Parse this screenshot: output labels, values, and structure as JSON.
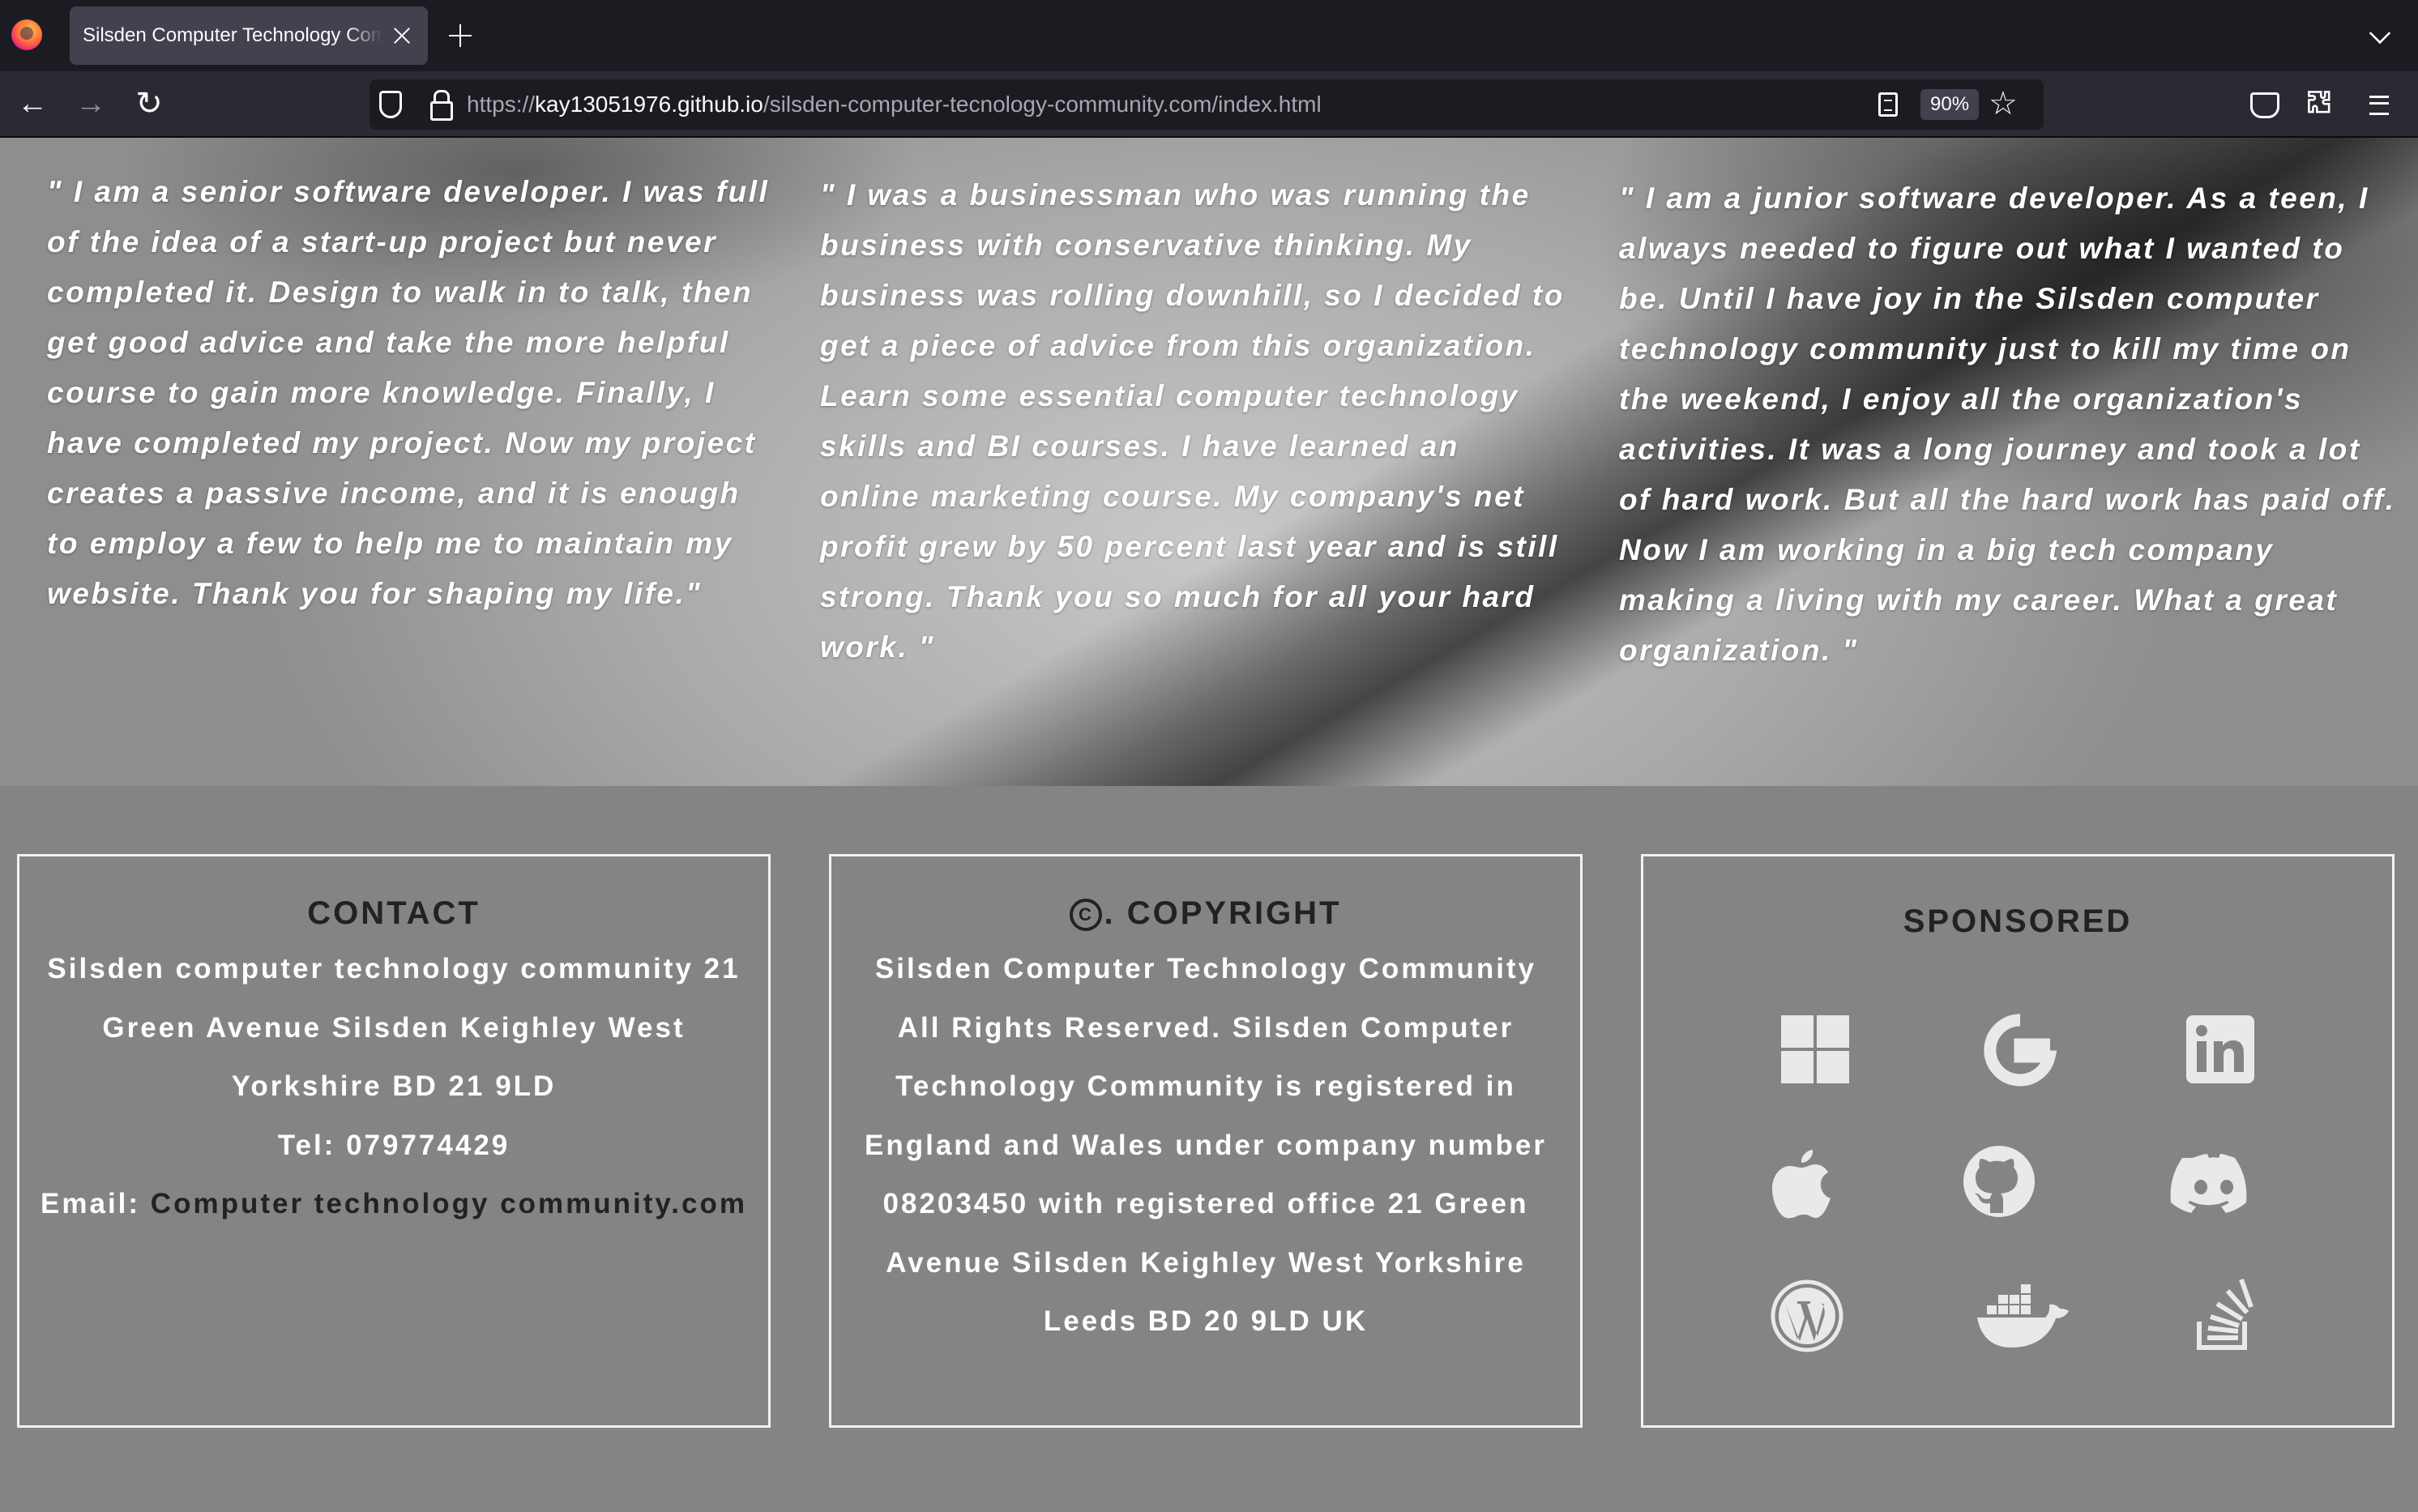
{
  "browser": {
    "tab_title": "Silsden Computer Technology Community",
    "url_scheme": "https://",
    "url_host": "kay13051976.github.io",
    "url_path": "/silsden-computer-tecnology-community.com/index.html",
    "zoom": "90%"
  },
  "testimonials": [
    "\" I am a senior software developer. I was full of the idea of a start-up project but never completed it. Design to walk in to talk, then get good advice and take the more helpful course to gain more knowledge. Finally, I have completed my project. Now my project creates a passive income, and it is enough to employ a few to help me to maintain my website. Thank you for shaping my life.\"",
    "\" I was a businessman who was running the business with conservative thinking. My business was rolling downhill, so I decided to get a piece of advice from this organization. Learn some essential computer technology skills and BI courses. I have learned an online marketing course. My company's net profit grew by 50 percent last year and is still strong. Thank you so much for all your hard work. \"",
    "\" I am a junior software developer. As a teen, I always needed to figure out what I wanted to be. Until I have joy in the Silsden computer technology community just to kill my time on the weekend, I enjoy all the organization's activities. It was a long journey and took a lot of hard work. But all the hard work has paid off. Now I am working in a big tech company making a living with my career. What a great organization. \""
  ],
  "contact": {
    "heading": "CONTACT",
    "address": "Silsden computer technology community 21 Green Avenue Silsden Keighley West Yorkshire BD 21 9LD",
    "tel": "Tel: 079774429",
    "email_label": "Email:",
    "email_link": "Computer technology community.com"
  },
  "copyright": {
    "symbol": "C",
    "heading": ". COPYRIGHT",
    "text": "Silsden Computer Technology Community All Rights Reserved. Silsden Computer Technology Community is registered in England and Wales under company number 08203450 with registered office 21 Green Avenue Silsden Keighley West Yorkshire Leeds BD 20 9LD UK"
  },
  "sponsored": {
    "heading": "SPONSORED",
    "icons": [
      "windows-icon",
      "google-icon",
      "linkedin-icon",
      "apple-icon",
      "github-icon",
      "discord-icon",
      "wordpress-icon",
      "docker-icon",
      "stackoverflow-icon"
    ]
  },
  "colors": {
    "page_bg": "#858385",
    "heading_dark": "#222222",
    "text_light": "#ffffff",
    "icon_color": "#e9e9e9"
  }
}
